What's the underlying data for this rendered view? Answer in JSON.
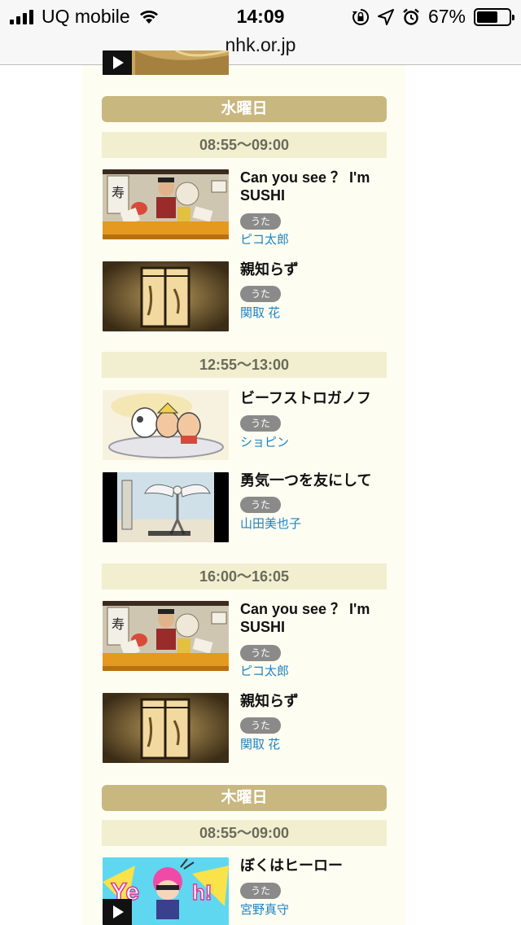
{
  "status_bar": {
    "carrier": "UQ mobile",
    "time": "14:09",
    "battery_percent": "67%",
    "battery_level": 0.67
  },
  "url_bar": {
    "domain": "nhk.or.jp"
  },
  "colors": {
    "day_header_bg": "#c8b77f",
    "time_header_bg": "#f1efd0",
    "artist_link": "#1d83c4",
    "tag_bg": "#8a8a8a",
    "content_bg": "#fefdf2"
  },
  "schedule": {
    "days": [
      {
        "label": "水曜日",
        "slots": [
          {
            "time": "08:55〜09:00",
            "items": [
              {
                "title": "Can you see ？ I'm SUSHI",
                "tag": "うた",
                "artist": "ピコ太郎",
                "thumbnail": "sushi-scene"
              },
              {
                "title": "親知らず",
                "tag": "うた",
                "artist": "関取 花",
                "thumbnail": "paper-lantern"
              }
            ]
          },
          {
            "time": "12:55〜13:00",
            "items": [
              {
                "title": "ビーフストロガノフ",
                "tag": "うた",
                "artist": "ショピン",
                "thumbnail": "cartoon-plate"
              },
              {
                "title": "勇気一つを友にして",
                "tag": "うた",
                "artist": "山田美也子",
                "thumbnail": "winged-figure"
              }
            ]
          },
          {
            "time": "16:00〜16:05",
            "items": [
              {
                "title": "Can you see ？ I'm SUSHI",
                "tag": "うた",
                "artist": "ピコ太郎",
                "thumbnail": "sushi-scene"
              },
              {
                "title": "親知らず",
                "tag": "うた",
                "artist": "関取 花",
                "thumbnail": "paper-lantern"
              }
            ]
          }
        ]
      },
      {
        "label": "木曜日",
        "slots": [
          {
            "time": "08:55〜09:00",
            "items": [
              {
                "title": "ぼくはヒーロー",
                "tag": "うた",
                "artist": "宮野真守",
                "thumbnail": "hero-cartoon"
              }
            ]
          }
        ]
      }
    ]
  }
}
